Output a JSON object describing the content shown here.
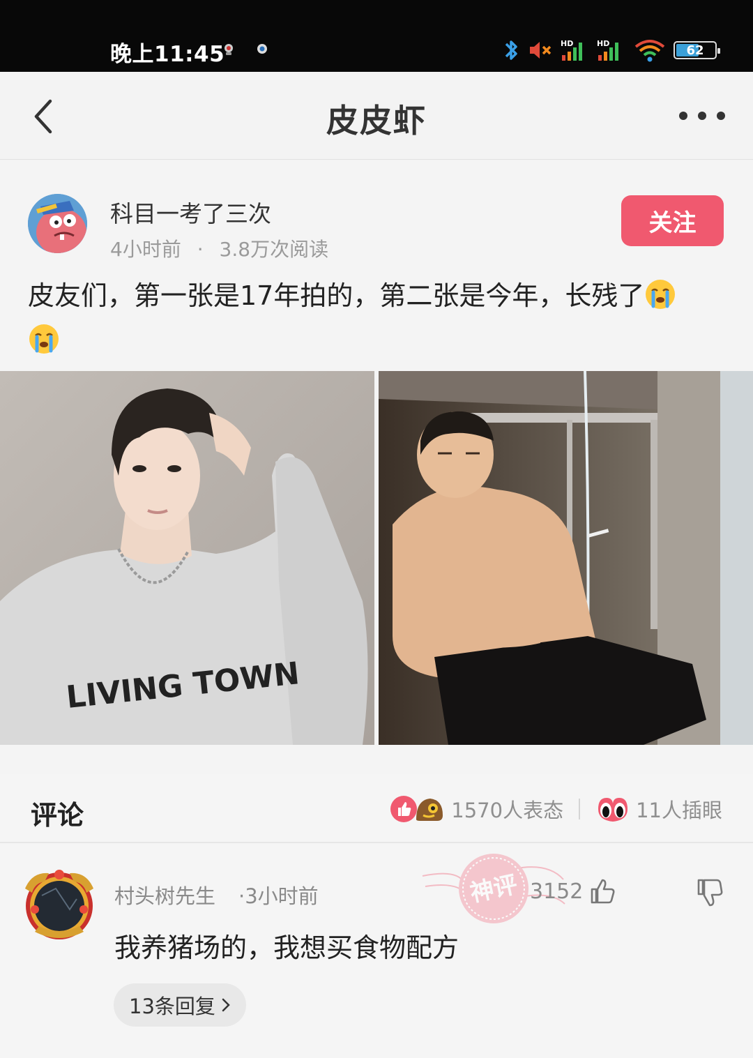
{
  "status_bar": {
    "time": "晚上11:45",
    "battery": "62",
    "battery_level": 0.62,
    "icons": [
      "notification-icon",
      "notification-icon",
      "bluetooth-icon",
      "mute-icon",
      "signal-icon",
      "signal-icon",
      "wifi-icon",
      "battery-icon"
    ],
    "hd_label": "HD"
  },
  "header": {
    "title": "皮皮虾",
    "back_icon": "chevron-left-icon",
    "more_icon": "more-dots-icon"
  },
  "post": {
    "author": "科目一考了三次",
    "time": "4小时前",
    "separator": "·",
    "reads": "3.8万次阅读",
    "follow_label": "关注",
    "text": "皮友们，第一张是17年拍的，第二张是今年，长残了",
    "images": [
      {
        "desc_icon": "photo-icon",
        "sweatshirt_text": "LIVING TOWN"
      },
      {
        "desc_icon": "photo-icon"
      }
    ],
    "colors": {
      "follow": "#f0596f"
    }
  },
  "comments": {
    "title": "评论",
    "reactions_count": "1570人表态",
    "pokes_count": "11人插眼",
    "items": [
      {
        "user": "村头树先生",
        "time": "·3小时前",
        "likes": "3152",
        "text": "我养猪场的，我想买食物配方",
        "replies_label": "13条回复",
        "badge": "神评"
      }
    ]
  }
}
